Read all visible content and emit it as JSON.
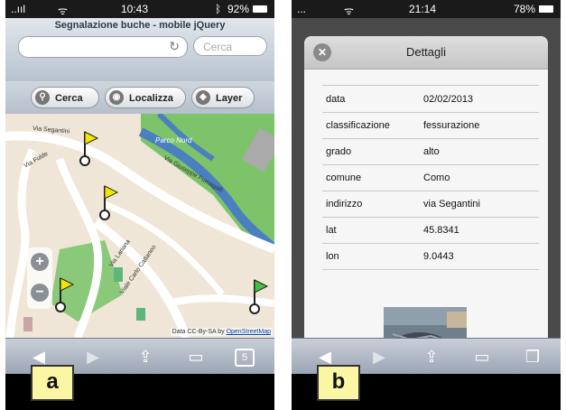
{
  "phone_a": {
    "label": "a",
    "status": {
      "signal": "..ııl",
      "wifi": "ᯤ",
      "time": "10:43",
      "bluetooth": "ᛒ",
      "battery": "92%"
    },
    "header_title": "Segnalazione buche - mobile jQuery",
    "search_value": "",
    "search_placeholder": "Cerca",
    "buttons": [
      {
        "label": "Cerca",
        "icon": "search-icon"
      },
      {
        "label": "Localizza",
        "icon": "locate-icon"
      },
      {
        "label": "Layer",
        "icon": "layers-icon"
      }
    ],
    "map_labels": {
      "street1": "Via Segantini",
      "street2": "Via Fulde",
      "street3": "Via Giuseppe Fumagalli",
      "street4": "Via Lariana",
      "street5": "Viale Carlo Cattaneo",
      "park": "Parco Nord"
    },
    "zoom_in": "+",
    "zoom_out": "−",
    "attribution": "Data CC-By-SA by",
    "attribution_link": "OpenStreetMap",
    "tab_count": "5"
  },
  "phone_b": {
    "label": "b",
    "status": {
      "signal": "...",
      "wifi": "ᯤ",
      "time": "21:14",
      "battery": "78%"
    },
    "dialog_title": "Dettagli",
    "close_symbol": "✕",
    "rows": [
      {
        "key": "data",
        "value": "02/02/2013"
      },
      {
        "key": "classificazione",
        "value": "fessurazione"
      },
      {
        "key": "grado",
        "value": "alto"
      },
      {
        "key": "comune",
        "value": "Como"
      },
      {
        "key": "indirizzo",
        "value": "via Segantini"
      },
      {
        "key": "lat",
        "value": "45.8341"
      },
      {
        "key": "lon",
        "value": "9.0443"
      }
    ]
  },
  "colors": {
    "flag_yellow": "#f2e600",
    "flag_green": "#3fc23f",
    "road": "#ffffff",
    "park": "#6fbf5a",
    "river": "#4a7fc0"
  }
}
